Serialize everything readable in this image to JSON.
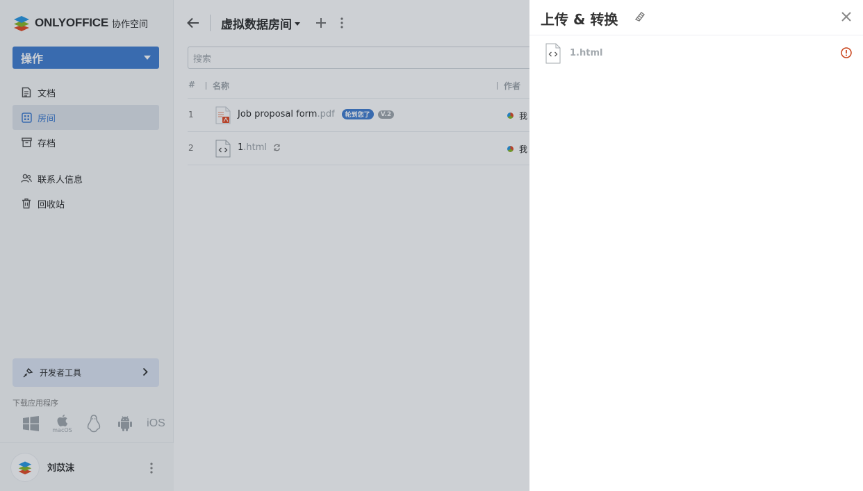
{
  "brand": {
    "name": "ONLYOFFICE",
    "suffix": "协作空间"
  },
  "sidebar": {
    "action_label": "操作",
    "items": [
      {
        "label": "文档",
        "icon": "document-icon"
      },
      {
        "label": "房间",
        "icon": "rooms-icon",
        "active": true
      },
      {
        "label": "存档",
        "icon": "archive-icon"
      },
      {
        "label": "联系人信息",
        "icon": "contacts-icon"
      },
      {
        "label": "回收站",
        "icon": "trash-icon"
      }
    ],
    "dev_tools_label": "开发者工具",
    "download_label": "下载应用程序",
    "apps": [
      "windows-icon",
      "macos-icon",
      "linux-icon",
      "android-icon",
      "ios-icon"
    ],
    "macos_label": "macOS",
    "ios_label": "iOS",
    "user_name": "刘苡沫"
  },
  "main": {
    "title": "虚拟数据房间",
    "search_placeholder": "搜索",
    "columns": {
      "num": "#",
      "name": "名称",
      "author": "作者"
    },
    "rows": [
      {
        "num": "1",
        "name": "Job proposal form",
        "ext": ".pdf",
        "badge_new": "轮到您了",
        "badge_version": "V.2",
        "author": "我"
      },
      {
        "num": "2",
        "name": "1",
        "ext": ".html",
        "author": "我"
      }
    ]
  },
  "panel": {
    "title": "上传 & 转换",
    "files": [
      {
        "name": "1.html",
        "status": "error"
      }
    ]
  },
  "colors": {
    "accent": "#4781d1",
    "error": "#c9431a",
    "muted": "#a3a9ae"
  }
}
